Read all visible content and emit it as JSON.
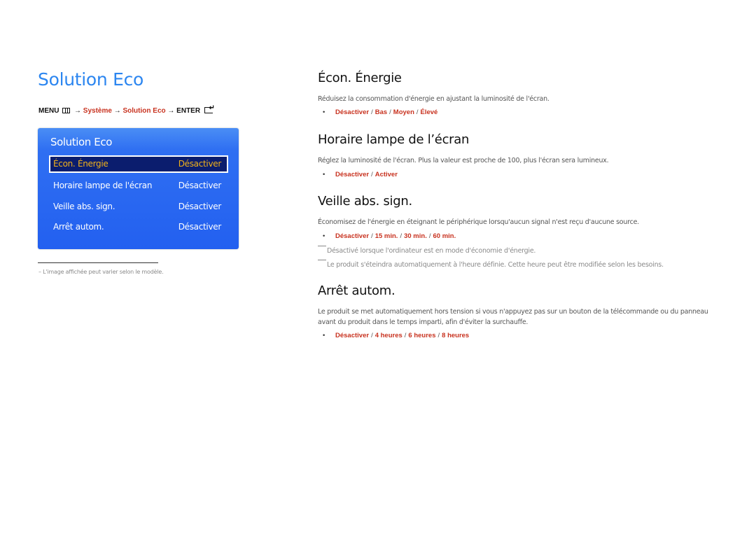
{
  "page_title": "Solution Eco",
  "menu_path": {
    "menu": "MENU",
    "menu_icon": "menu-icon",
    "arrow": "→",
    "system": "Système",
    "solution_eco": "Solution Eco",
    "enter": "ENTER",
    "enter_icon": "enter-icon"
  },
  "osd": {
    "title": "Solution Eco",
    "items": [
      {
        "label": "Écon. Énergie",
        "value": "Désactiver",
        "selected": true
      },
      {
        "label": "Horaire lampe de l'écran",
        "value": "Désactiver",
        "selected": false
      },
      {
        "label": "Veille abs. sign.",
        "value": "Désactiver",
        "selected": false
      },
      {
        "label": "Arrêt autom.",
        "value": "Désactiver",
        "selected": false
      }
    ]
  },
  "footnote": "– L'image affichée peut varier selon le modèle.",
  "sections": [
    {
      "title": "Écon. Énergie",
      "description": "Réduisez la consommation d'énergie en ajustant la luminosité de l'écran.",
      "options": [
        "Désactiver",
        "Bas",
        "Moyen",
        "Élevé"
      ]
    },
    {
      "title": "Horaire lampe de l’écran",
      "description": "Réglez la luminosité de l'écran. Plus la valeur est proche de 100, plus l'écran sera lumineux.",
      "options": [
        "Désactiver",
        "Activer"
      ]
    },
    {
      "title": "Veille abs. sign.",
      "description": "Économisez de l'énergie en éteignant le périphérique lorsqu'aucun signal n'est reçu d'aucune source.",
      "options": [
        "Désactiver",
        "15 min.",
        "30 min.",
        "60 min."
      ],
      "notes": [
        "Désactivé lorsque l'ordinateur est en mode d'économie d'énergie.",
        "Le produit s'éteindra automatiquement à l'heure définie. Cette heure peut être modifiée selon les besoins."
      ]
    },
    {
      "title": "Arrêt autom.",
      "description": "Le produit se met automatiquement hors tension si vous n'appuyez pas sur un bouton de la télécommande ou du panneau avant du produit dans le temps imparti, afin d'éviter la surchauffe.",
      "options": [
        "Désactiver",
        "4 heures",
        "6 heures",
        "8 heures"
      ]
    }
  ],
  "bullet": "•",
  "separator": "/",
  "colors": {
    "title_blue": "#2c86f0",
    "option_red": "#c8321f",
    "osd_blue": "#2360f0",
    "osd_selected_bg": "#0b1d6e",
    "osd_selected_text": "#f2b21a"
  }
}
